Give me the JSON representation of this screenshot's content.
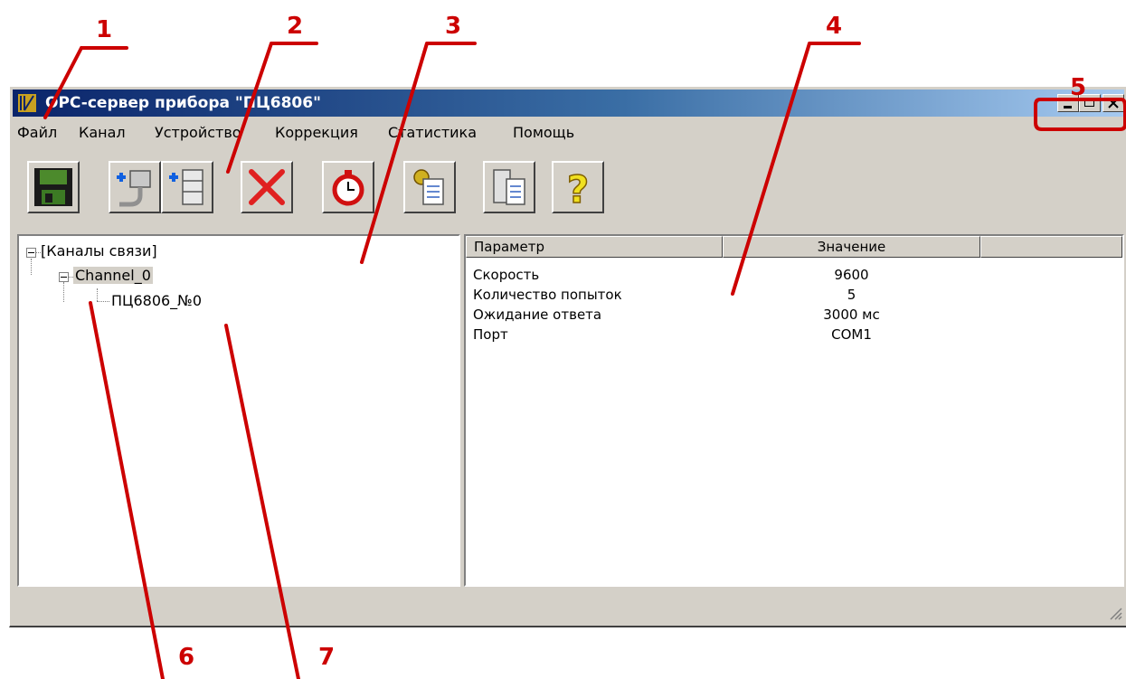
{
  "window": {
    "title": "OPC-сервер прибора \"ПЦ6806\"",
    "controls": [
      "minimize",
      "maximize",
      "close"
    ]
  },
  "menu": {
    "items": [
      "Файл",
      "Канал",
      "Устройство",
      "Коррекция",
      "Статистика",
      "Помощь"
    ]
  },
  "toolbar": {
    "buttons": [
      {
        "icon": "save-icon"
      },
      {
        "icon": "add-channel-icon"
      },
      {
        "icon": "add-device-icon"
      },
      {
        "icon": "delete-icon"
      },
      {
        "icon": "timer-icon"
      },
      {
        "icon": "settings-icon"
      },
      {
        "icon": "device-properties-icon"
      },
      {
        "icon": "help-icon"
      }
    ]
  },
  "tree": {
    "root": "[Каналы связи]",
    "channel": "Channel_0",
    "device": "ПЦ6806_№0"
  },
  "properties": {
    "columns": [
      "Параметр",
      "Значение"
    ],
    "rows": [
      {
        "param": "Скорость",
        "value": "9600"
      },
      {
        "param": "Количество попыток",
        "value": "5"
      },
      {
        "param": "Ожидание ответа",
        "value": "3000 мс"
      },
      {
        "param": "Порт",
        "value": "COM1"
      }
    ]
  },
  "annotations": [
    "1",
    "2",
    "3",
    "4",
    "5",
    "6",
    "7"
  ],
  "colors": {
    "annotation": "#cc0000",
    "titlebar_start": "#0a246a",
    "titlebar_end": "#a6caf0",
    "face": "#d4d0c8"
  }
}
